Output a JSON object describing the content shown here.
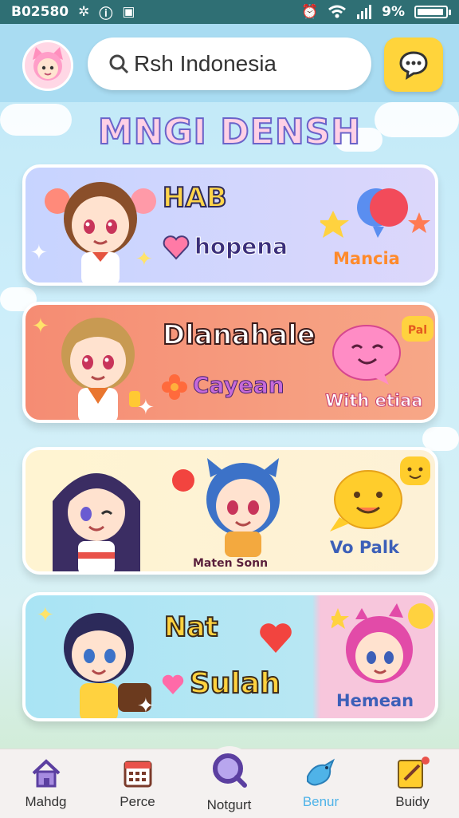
{
  "status_bar": {
    "time": "B02580",
    "battery_text": "9%",
    "battery_level": 0.93
  },
  "search": {
    "value": "Rsh Indonesia"
  },
  "app_title": "MNGI DENSH",
  "cards": [
    {
      "title": "HAB",
      "subtitle": "hopena",
      "side_label": "Mancia"
    },
    {
      "title": "Dlanahale",
      "subtitle": "Cayean",
      "side_label": "With etiaa",
      "bubble_text": "Pal"
    },
    {
      "caption": "Maten Sonn",
      "side_label": "Vo Palk"
    },
    {
      "title": "Nat",
      "subtitle": "Sulah",
      "side_label": "Hemean"
    }
  ],
  "bottom_nav": [
    {
      "label": "Mahdg",
      "icon": "home-icon"
    },
    {
      "label": "Perce",
      "icon": "calendar-icon"
    },
    {
      "label": "Notgurt",
      "icon": "search-icon"
    },
    {
      "label": "Benur",
      "icon": "bird-icon",
      "active": true
    },
    {
      "label": "Buidy",
      "icon": "note-icon"
    }
  ],
  "colors": {
    "header": "#a9dcf2",
    "accent_yellow": "#ffd43b",
    "nav_active": "#4fb3e8",
    "title_outline": "#6a63c9"
  }
}
